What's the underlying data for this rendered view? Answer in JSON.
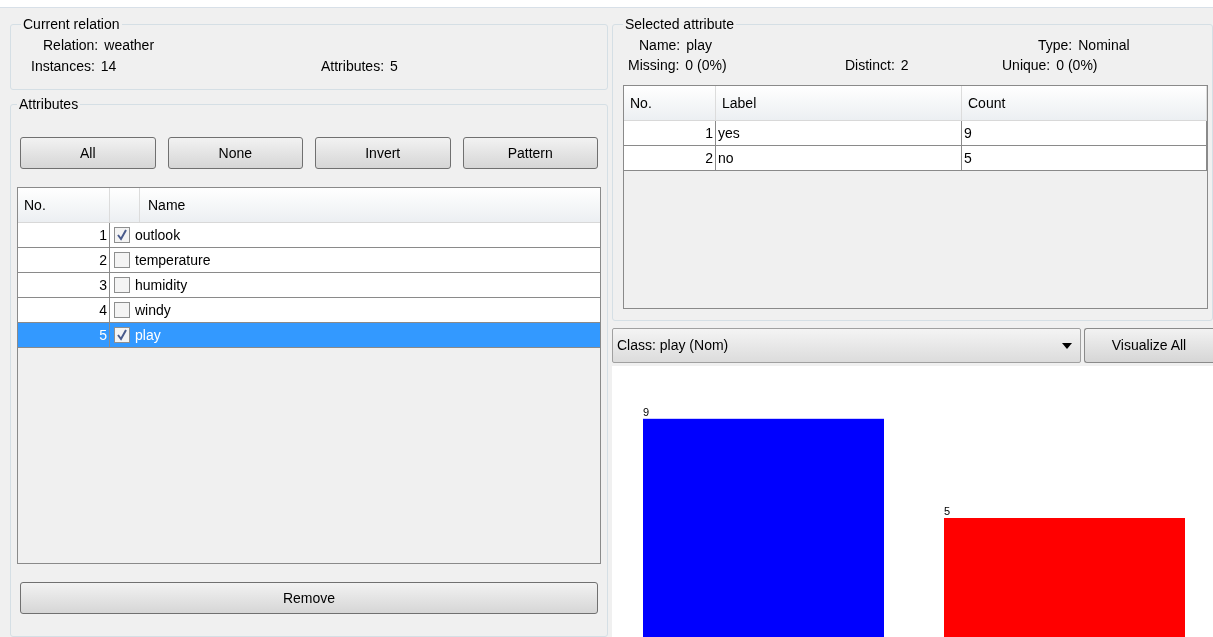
{
  "current_relation": {
    "title": "Current relation",
    "relation_label": "Relation:",
    "relation": "weather",
    "instances_label": "Instances:",
    "instances": "14",
    "attributes_label": "Attributes:",
    "attributes": "5"
  },
  "attributes_panel": {
    "title": "Attributes",
    "buttons": [
      "All",
      "None",
      "Invert",
      "Pattern"
    ],
    "table": {
      "columns": [
        "No.",
        "Name"
      ],
      "rows": [
        {
          "no": "1",
          "name": "outlook",
          "checked": true,
          "selected": false
        },
        {
          "no": "2",
          "name": "temperature",
          "checked": false,
          "selected": false
        },
        {
          "no": "3",
          "name": "humidity",
          "checked": false,
          "selected": false
        },
        {
          "no": "4",
          "name": "windy",
          "checked": false,
          "selected": false
        },
        {
          "no": "5",
          "name": "play",
          "checked": true,
          "selected": true
        }
      ]
    },
    "remove_button": "Remove"
  },
  "selected_attribute": {
    "title": "Selected attribute",
    "fields": [
      {
        "label": "Name:",
        "value": "play"
      },
      {
        "label": "Type:",
        "value": "Nominal"
      },
      {
        "label": "Missing:",
        "value": "0 (0%)"
      },
      {
        "label": "Distinct:",
        "value": "2"
      },
      {
        "label": "Unique:",
        "value": "0 (0%)"
      }
    ],
    "table": {
      "columns": [
        "No.",
        "Label",
        "Count"
      ],
      "rows": [
        [
          "1",
          "yes",
          "9"
        ],
        [
          "2",
          "no",
          "5"
        ]
      ]
    }
  },
  "class_dropdown": "Class: play (Nom)",
  "visualize_button": "Visualize All",
  "chart_data": {
    "type": "bar",
    "data_labels": true,
    "categories": [
      null,
      null
    ],
    "series": [
      {
        "colors": [
          "#0000ff",
          "#ff0000"
        ],
        "values": [
          9,
          5
        ]
      }
    ]
  }
}
